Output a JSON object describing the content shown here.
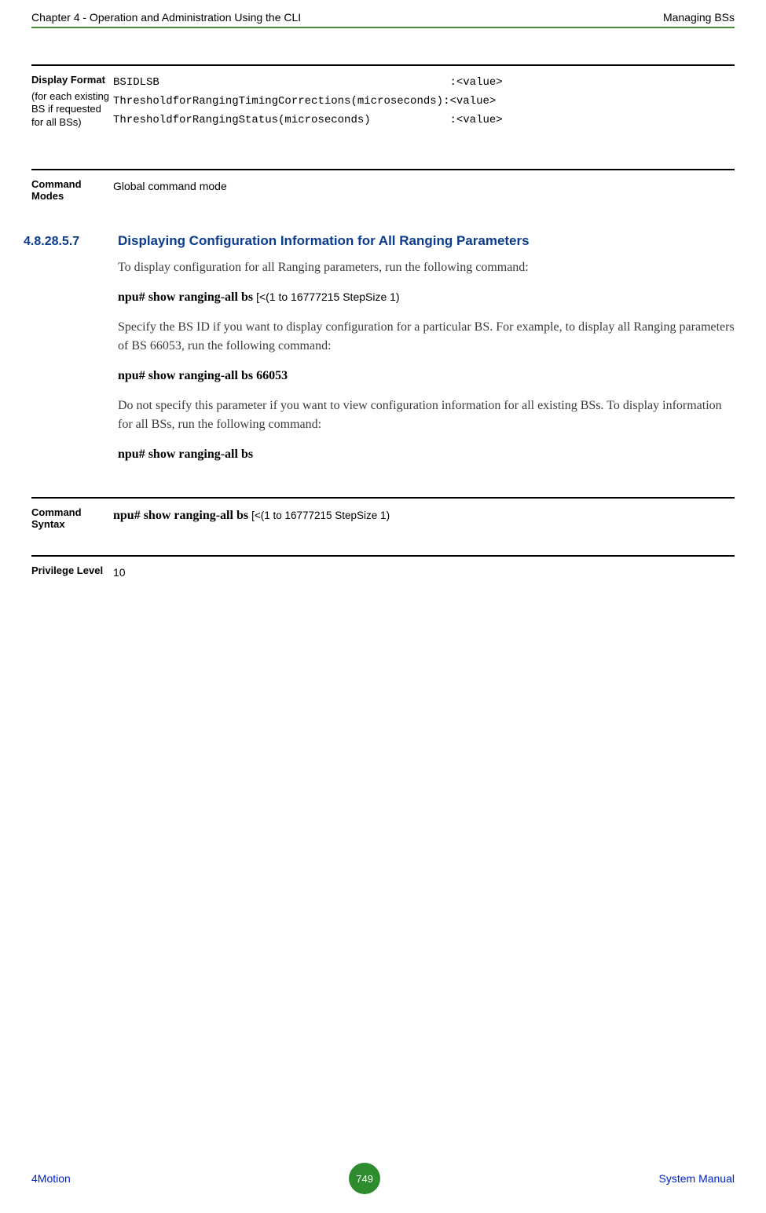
{
  "header": {
    "left": "Chapter 4 - Operation and Administration Using the CLI",
    "right": "Managing BSs"
  },
  "display_format": {
    "label": "Display Format",
    "sub": "(for each existing BS if requested for all BSs)",
    "line1": "BSIDLSB                                            :<value>",
    "line2": "ThresholdforRangingTimingCorrections(microseconds):<value>",
    "line3": "ThresholdforRangingStatus(microseconds)            :<value>"
  },
  "command_modes": {
    "label": "Command Modes",
    "value": "Global command mode"
  },
  "section": {
    "number": "4.8.28.5.7",
    "title": "Displaying Configuration Information for All Ranging Parameters"
  },
  "body": {
    "p1": "To display configuration for all Ranging parameters, run the following command:",
    "cmd1_b": "npu# show ranging-all bs ",
    "cmd1_args": "[<(1 to 16777215 StepSize 1)",
    "p2": "Specify the BS ID if you want to display configuration for a particular BS. For example, to display all Ranging parameters of BS 66053, run the following command:",
    "cmd2": "npu# show ranging-all bs 66053",
    "p3": "Do not specify this parameter if you want to view configuration information for all existing BSs. To display information for all BSs, run the following command:",
    "cmd3": "npu# show ranging-all bs"
  },
  "command_syntax": {
    "label": "Command Syntax",
    "value_b": "npu# show ranging-all bs ",
    "value_args": "[<(1 to 16777215 StepSize 1)"
  },
  "privilege": {
    "label": "Privilege Level",
    "value": "10"
  },
  "footer": {
    "left": "4Motion",
    "page": "749",
    "right": "System Manual"
  }
}
